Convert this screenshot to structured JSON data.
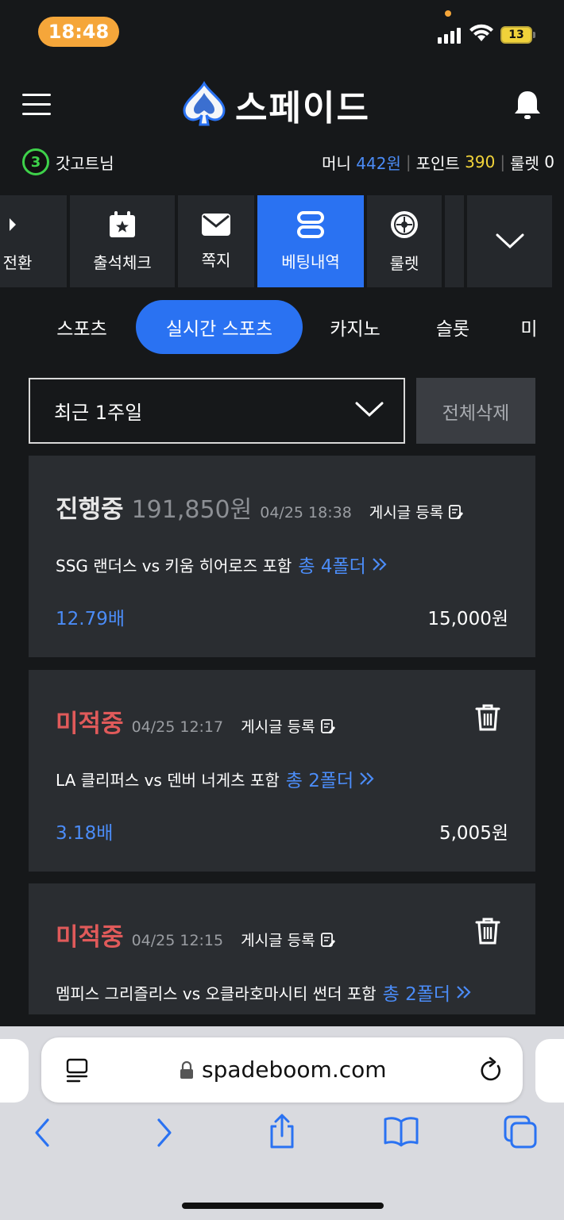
{
  "status_bar": {
    "time": "18:48",
    "battery": "13"
  },
  "header": {
    "logo_text": "스페이드"
  },
  "user": {
    "level": "3",
    "name": "갓고트님",
    "money_label": "머니",
    "money_value": "442원",
    "point_label": "포인트",
    "point_value": "390",
    "roulette_label": "룰렛",
    "roulette_value": "0"
  },
  "quick_menu": [
    {
      "label": "전환",
      "icon": "switch-icon"
    },
    {
      "label": "출석체크",
      "icon": "calendar-star-icon"
    },
    {
      "label": "쪽지",
      "icon": "mail-icon"
    },
    {
      "label": "베팅내역",
      "icon": "betting-history-icon",
      "active": true
    },
    {
      "label": "룰렛",
      "icon": "roulette-icon"
    },
    {
      "label": "",
      "icon": "chevron-down-icon"
    }
  ],
  "tabs": [
    {
      "label": "스포츠"
    },
    {
      "label": "실시간 스포츠",
      "active": true
    },
    {
      "label": "카지노"
    },
    {
      "label": "슬롯"
    },
    {
      "label": "미"
    }
  ],
  "filter": {
    "period": "최근 1주일",
    "delete_all": "전체삭제"
  },
  "bets": [
    {
      "status": "진행중",
      "amount": "191,850원",
      "datetime": "04/25 18:38",
      "post_label": "게시글 등록",
      "match": "SSG 랜더스 vs 키움 히어로즈 포함",
      "fold": "총 4폴더",
      "odds": "12.79배",
      "stake": "15,000원"
    },
    {
      "status": "미적중",
      "datetime": "04/25 12:17",
      "post_label": "게시글 등록",
      "match": "LA 클리퍼스 vs 덴버 너게츠 포함",
      "fold": "총 2폴더",
      "odds": "3.18배",
      "stake": "5,005원"
    },
    {
      "status": "미적중",
      "datetime": "04/25 12:15",
      "post_label": "게시글 등록",
      "match": "멤피스 그리즐리스 vs 오클라호마시티 썬더 포함",
      "fold": "총 2폴더"
    }
  ],
  "browser": {
    "url": "spadeboom.com"
  },
  "colors": {
    "accent": "#2a72f2",
    "link_blue": "#4b8cf7",
    "miss_red": "#e05a5a",
    "point_yellow": "#f2d43a"
  }
}
